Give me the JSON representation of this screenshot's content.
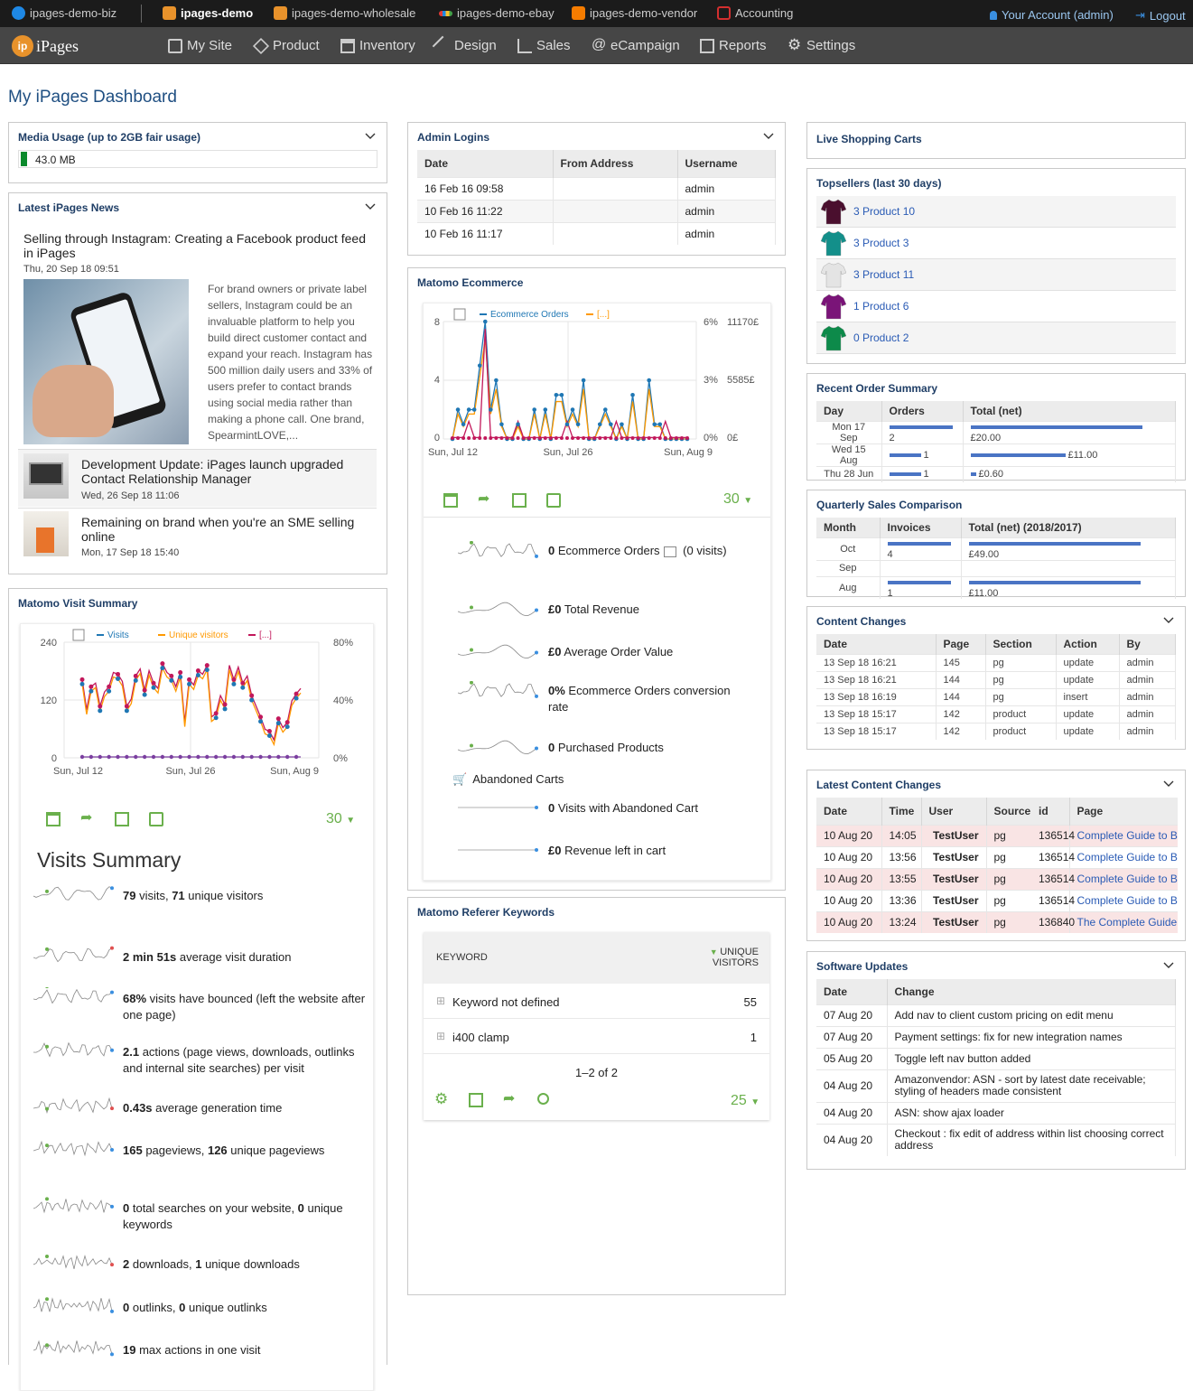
{
  "topbar": {
    "sites": [
      {
        "label": "ipages-demo-biz",
        "color": "#1e88e5"
      },
      {
        "label": "ipages-demo",
        "color": "#e8922b",
        "active": true
      },
      {
        "label": "ipages-demo-wholesale",
        "color": "#e8922b"
      },
      {
        "label": "ipages-demo-ebay",
        "color": "#e53935"
      },
      {
        "label": "ipages-demo-vendor",
        "color": "#f57c00"
      },
      {
        "label": "Accounting",
        "color": "#d32f2f"
      }
    ],
    "account": "Your Account (admin)",
    "logout": "Logout"
  },
  "nav": {
    "logo": "iPages",
    "logo_badge": "ip",
    "items": [
      "My Site",
      "Product",
      "Inventory",
      "Design",
      "Sales",
      "eCampaign",
      "Reports",
      "Settings"
    ]
  },
  "page_title": "My iPages Dashboard",
  "media": {
    "title": "Media Usage (up to 2GB fair usage)",
    "value": "43.0 MB"
  },
  "news": {
    "title": "Latest iPages News",
    "items": [
      {
        "title": "Selling through Instagram: Creating a Facebook product feed in iPages",
        "date": "Thu, 20 Sep 18 09:51",
        "body": "For brand owners or private label sellers, Instagram could be an invaluable platform to help you build direct customer contact and expand your reach. Instagram has 500 million daily users and 33% of users prefer to contact brands using social media rather than making a phone call. One brand, SpearmintLOVE,..."
      },
      {
        "title": "Development Update: iPages launch upgraded Contact Relationship Manager",
        "date": "Wed, 26 Sep 18 11:06"
      },
      {
        "title": "Remaining on brand when you're an SME selling online",
        "date": "Mon, 17 Sep 18 15:40"
      }
    ]
  },
  "admin_logins": {
    "title": "Admin Logins",
    "headers": [
      "Date",
      "From Address",
      "Username"
    ],
    "rows": [
      {
        "date": "16 Feb 16 09:58",
        "user": "admin"
      },
      {
        "date": "10 Feb 16 11:22",
        "user": "admin"
      },
      {
        "date": "10 Feb 16 11:17",
        "user": "admin"
      }
    ]
  },
  "ecommerce": {
    "title": "Matomo Ecommerce",
    "legend": [
      "Ecommerce Orders",
      "[...]"
    ],
    "x_labels": [
      "Sun, Jul 12",
      "Sun, Jul 26",
      "Sun, Aug 9"
    ],
    "y_left": [
      "8",
      "4",
      "0"
    ],
    "y_mid": [
      "6%",
      "3%",
      "0%"
    ],
    "y_right": [
      "11170£",
      "5585£",
      "0£"
    ],
    "period": "30",
    "metrics": [
      {
        "b": "0",
        "t": " Ecommerce Orders",
        "t2": " (0 visits)"
      },
      {
        "b": "£0",
        "t": " Total Revenue"
      },
      {
        "b": "£0",
        "t": " Average Order Value"
      },
      {
        "b": "0%",
        "t": " Ecommerce Orders conversion rate"
      },
      {
        "b": "0",
        "t": " Purchased Products"
      }
    ],
    "abandoned": "Abandoned Carts",
    "ab_metrics": [
      {
        "b": "0",
        "t": " Visits with Abandoned Cart"
      },
      {
        "b": "£0",
        "t": " Revenue left in cart"
      }
    ]
  },
  "keywords": {
    "title": "Matomo Referer Keywords",
    "col1": "KEYWORD",
    "col2": "UNIQUE VISITORS",
    "rows": [
      {
        "k": "Keyword not defined",
        "v": "55"
      },
      {
        "k": "i400 clamp",
        "v": "1"
      }
    ],
    "pager": "1–2 of 2",
    "limit": "25"
  },
  "visits": {
    "title": "Matomo Visit Summary",
    "legend": [
      "Visits",
      "Unique visitors",
      "[...]"
    ],
    "x_labels": [
      "Sun, Jul 12",
      "Sun, Jul 26",
      "Sun, Aug 9"
    ],
    "y_left": [
      "240",
      "120",
      "0"
    ],
    "y_right": [
      "80%",
      "40%",
      "0%"
    ],
    "period": "30",
    "heading": "Visits Summary",
    "metrics": [
      {
        "html": "<b>79</b> visits, <b>71</b> unique visitors"
      },
      {
        "html": "<b>2 min 51s</b> average visit duration"
      },
      {
        "html": "<b>68%</b> visits have bounced (left the website after one page)"
      },
      {
        "html": "<b>2.1</b> actions (page views, downloads, outlinks and internal site searches) per visit"
      },
      {
        "html": "<b>0.43s</b> average generation time"
      },
      {
        "html": "<b>165</b> pageviews, <b>126</b> unique pageviews"
      },
      {
        "html": "<b>0</b> total searches on your website, <b>0</b> unique keywords"
      },
      {
        "html": "<b>2</b> downloads, <b>1</b> unique downloads"
      },
      {
        "html": "<b>0</b> outlinks, <b>0</b> unique outlinks"
      },
      {
        "html": "<b>19</b> max actions in one visit"
      }
    ]
  },
  "live_carts": {
    "title": "Live Shopping Carts"
  },
  "topsellers": {
    "title": "Topsellers (last 30 days)",
    "items": [
      {
        "label": "3 Product 10",
        "color": "#4a0f2e"
      },
      {
        "label": "3 Product 3",
        "color": "#138f8a"
      },
      {
        "label": "3 Product 11",
        "color": "#e4e4e4"
      },
      {
        "label": "1 Product 6",
        "color": "#7a1478"
      },
      {
        "label": "0 Product 2",
        "color": "#0d8a4a"
      }
    ]
  },
  "recent_orders": {
    "title": "Recent Order Summary",
    "headers": [
      "Day",
      "Orders",
      "Total (net)"
    ],
    "rows": [
      {
        "day": "Mon 17 Sep",
        "orders": "2",
        "total": "£20.00",
        "ofrac": 1,
        "tfrac": 1
      },
      {
        "day": "Wed 15 Aug",
        "orders": "1",
        "total": "£11.00",
        "ofrac": 0.5,
        "tfrac": 0.55
      },
      {
        "day": "Thu 28 Jun",
        "orders": "1",
        "total": "£0.60",
        "ofrac": 0.5,
        "tfrac": 0.03
      }
    ]
  },
  "quarterly": {
    "title": "Quarterly Sales Comparison",
    "headers": [
      "Month",
      "Invoices",
      "Total (net) (2018/2017)"
    ],
    "rows": [
      {
        "m": "Oct",
        "inv": "4",
        "total": "£49.00",
        "ifrac": 1,
        "tfrac": 1
      },
      {
        "m": "Sep",
        "inv": "",
        "total": "",
        "ifrac": 0,
        "tfrac": 0
      },
      {
        "m": "Aug",
        "inv": "1",
        "total": "£11.00",
        "ifrac": 1,
        "tfrac": 1
      }
    ]
  },
  "content_changes": {
    "title": "Content Changes",
    "headers": [
      "Date",
      "Page",
      "Section",
      "Action",
      "By"
    ],
    "rows": [
      [
        "13 Sep 18 16:21",
        "145",
        "pg",
        "update",
        "admin"
      ],
      [
        "13 Sep 18 16:21",
        "144",
        "pg",
        "update",
        "admin"
      ],
      [
        "13 Sep 18 16:19",
        "144",
        "pg",
        "insert",
        "admin"
      ],
      [
        "13 Sep 18 15:17",
        "142",
        "product",
        "update",
        "admin"
      ],
      [
        "13 Sep 18 15:17",
        "142",
        "product",
        "update",
        "admin"
      ]
    ]
  },
  "latest_changes": {
    "title": "Latest Content Changes",
    "headers": [
      "Date",
      "Time",
      "User",
      "Source",
      "id",
      "Page"
    ],
    "rows": [
      [
        "10 Aug 20",
        "14:05",
        "TestUser",
        "pg",
        "136514",
        "Complete Guide to Ba"
      ],
      [
        "10 Aug 20",
        "13:56",
        "TestUser",
        "pg",
        "136514",
        "Complete Guide to Ba"
      ],
      [
        "10 Aug 20",
        "13:55",
        "TestUser",
        "pg",
        "136514",
        "Complete Guide to Ba"
      ],
      [
        "10 Aug 20",
        "13:36",
        "TestUser",
        "pg",
        "136514",
        "Complete Guide to Ba"
      ],
      [
        "10 Aug 20",
        "13:24",
        "TestUser",
        "pg",
        "136840",
        "The Complete Guide t"
      ]
    ]
  },
  "software": {
    "title": "Software Updates",
    "headers": [
      "Date",
      "Change"
    ],
    "rows": [
      [
        "07 Aug 20",
        "Add nav to client custom pricing on edit menu"
      ],
      [
        "07 Aug 20",
        "Payment settings: fix for new integration names"
      ],
      [
        "05 Aug 20",
        "Toggle left nav button added"
      ],
      [
        "04 Aug 20",
        "Amazonvendor: ASN - sort by latest date receivable; styling of headers made consistent"
      ],
      [
        "04 Aug 20",
        "ASN: show ajax loader"
      ],
      [
        "04 Aug 20",
        "Checkout : fix edit of address within list choosing correct address"
      ]
    ]
  }
}
